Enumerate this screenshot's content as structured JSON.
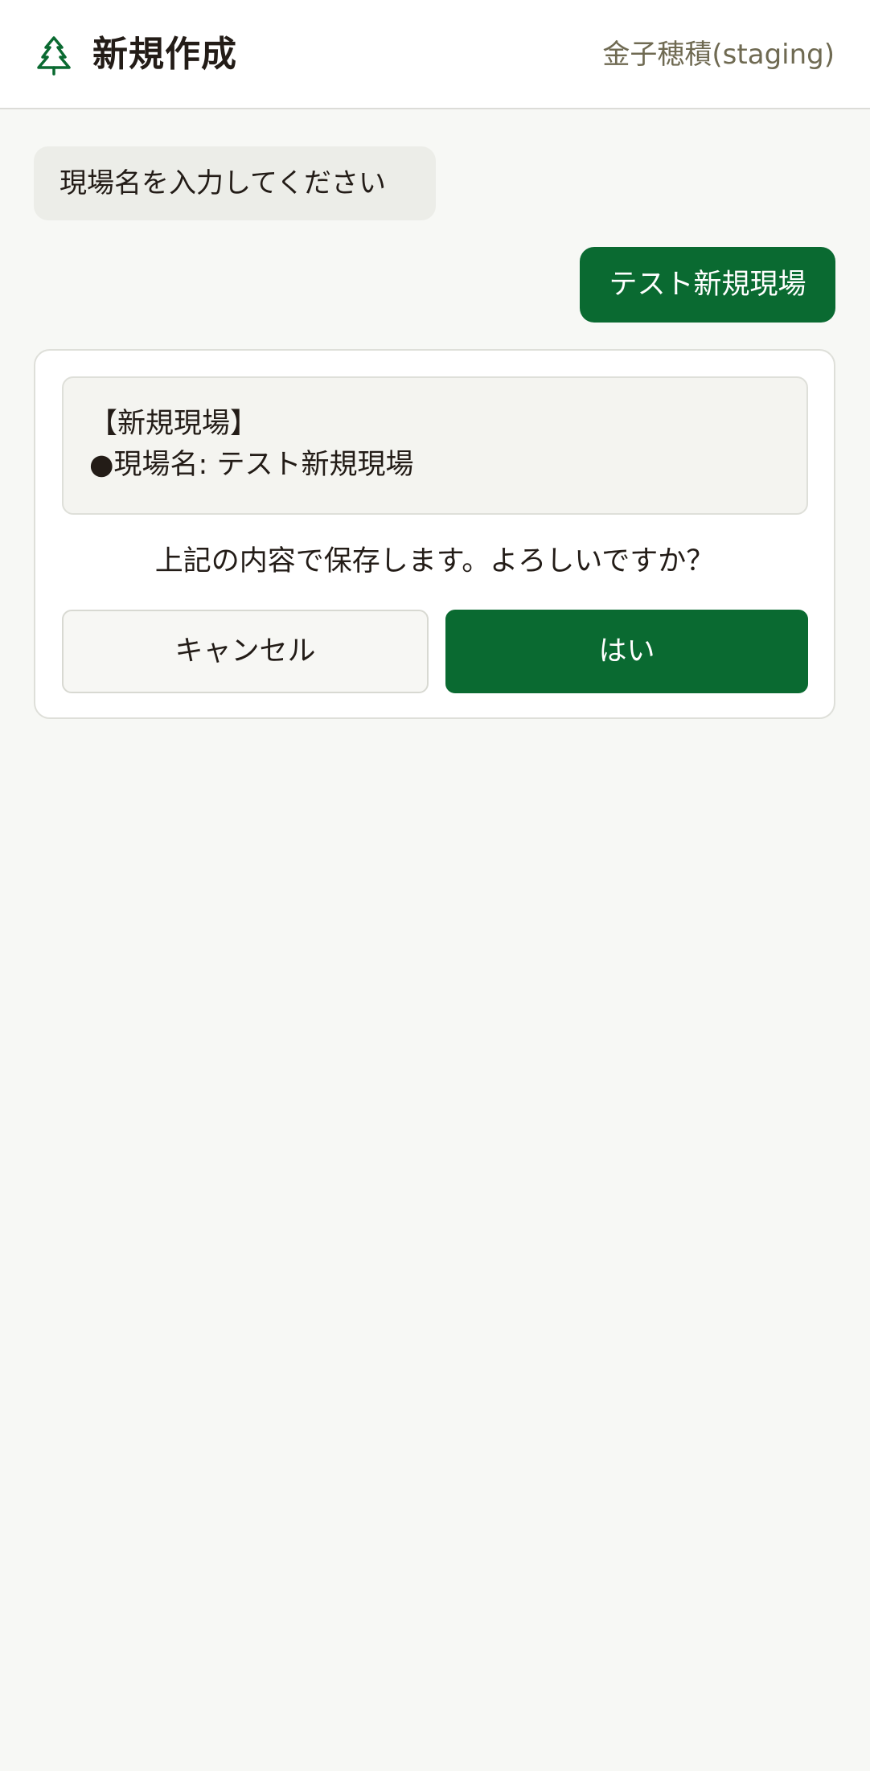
{
  "header": {
    "title": "新規作成",
    "user": "金子穂積(staging)"
  },
  "chat": {
    "bot_prompt": "現場名を入力してください",
    "user_reply": "テスト新規現場"
  },
  "confirm": {
    "summary_heading": "【新規現場】",
    "summary_line": "●現場名: テスト新規現場",
    "question": "上記の内容で保存します。よろしいですか？",
    "cancel_label": "キャンセル",
    "yes_label": "はい"
  },
  "colors": {
    "brand": "#0a6a31",
    "page_background": "#f7f8f5",
    "text": "#231c17",
    "user_name": "#6f6a52"
  },
  "icons": {
    "logo": "tree-icon"
  }
}
